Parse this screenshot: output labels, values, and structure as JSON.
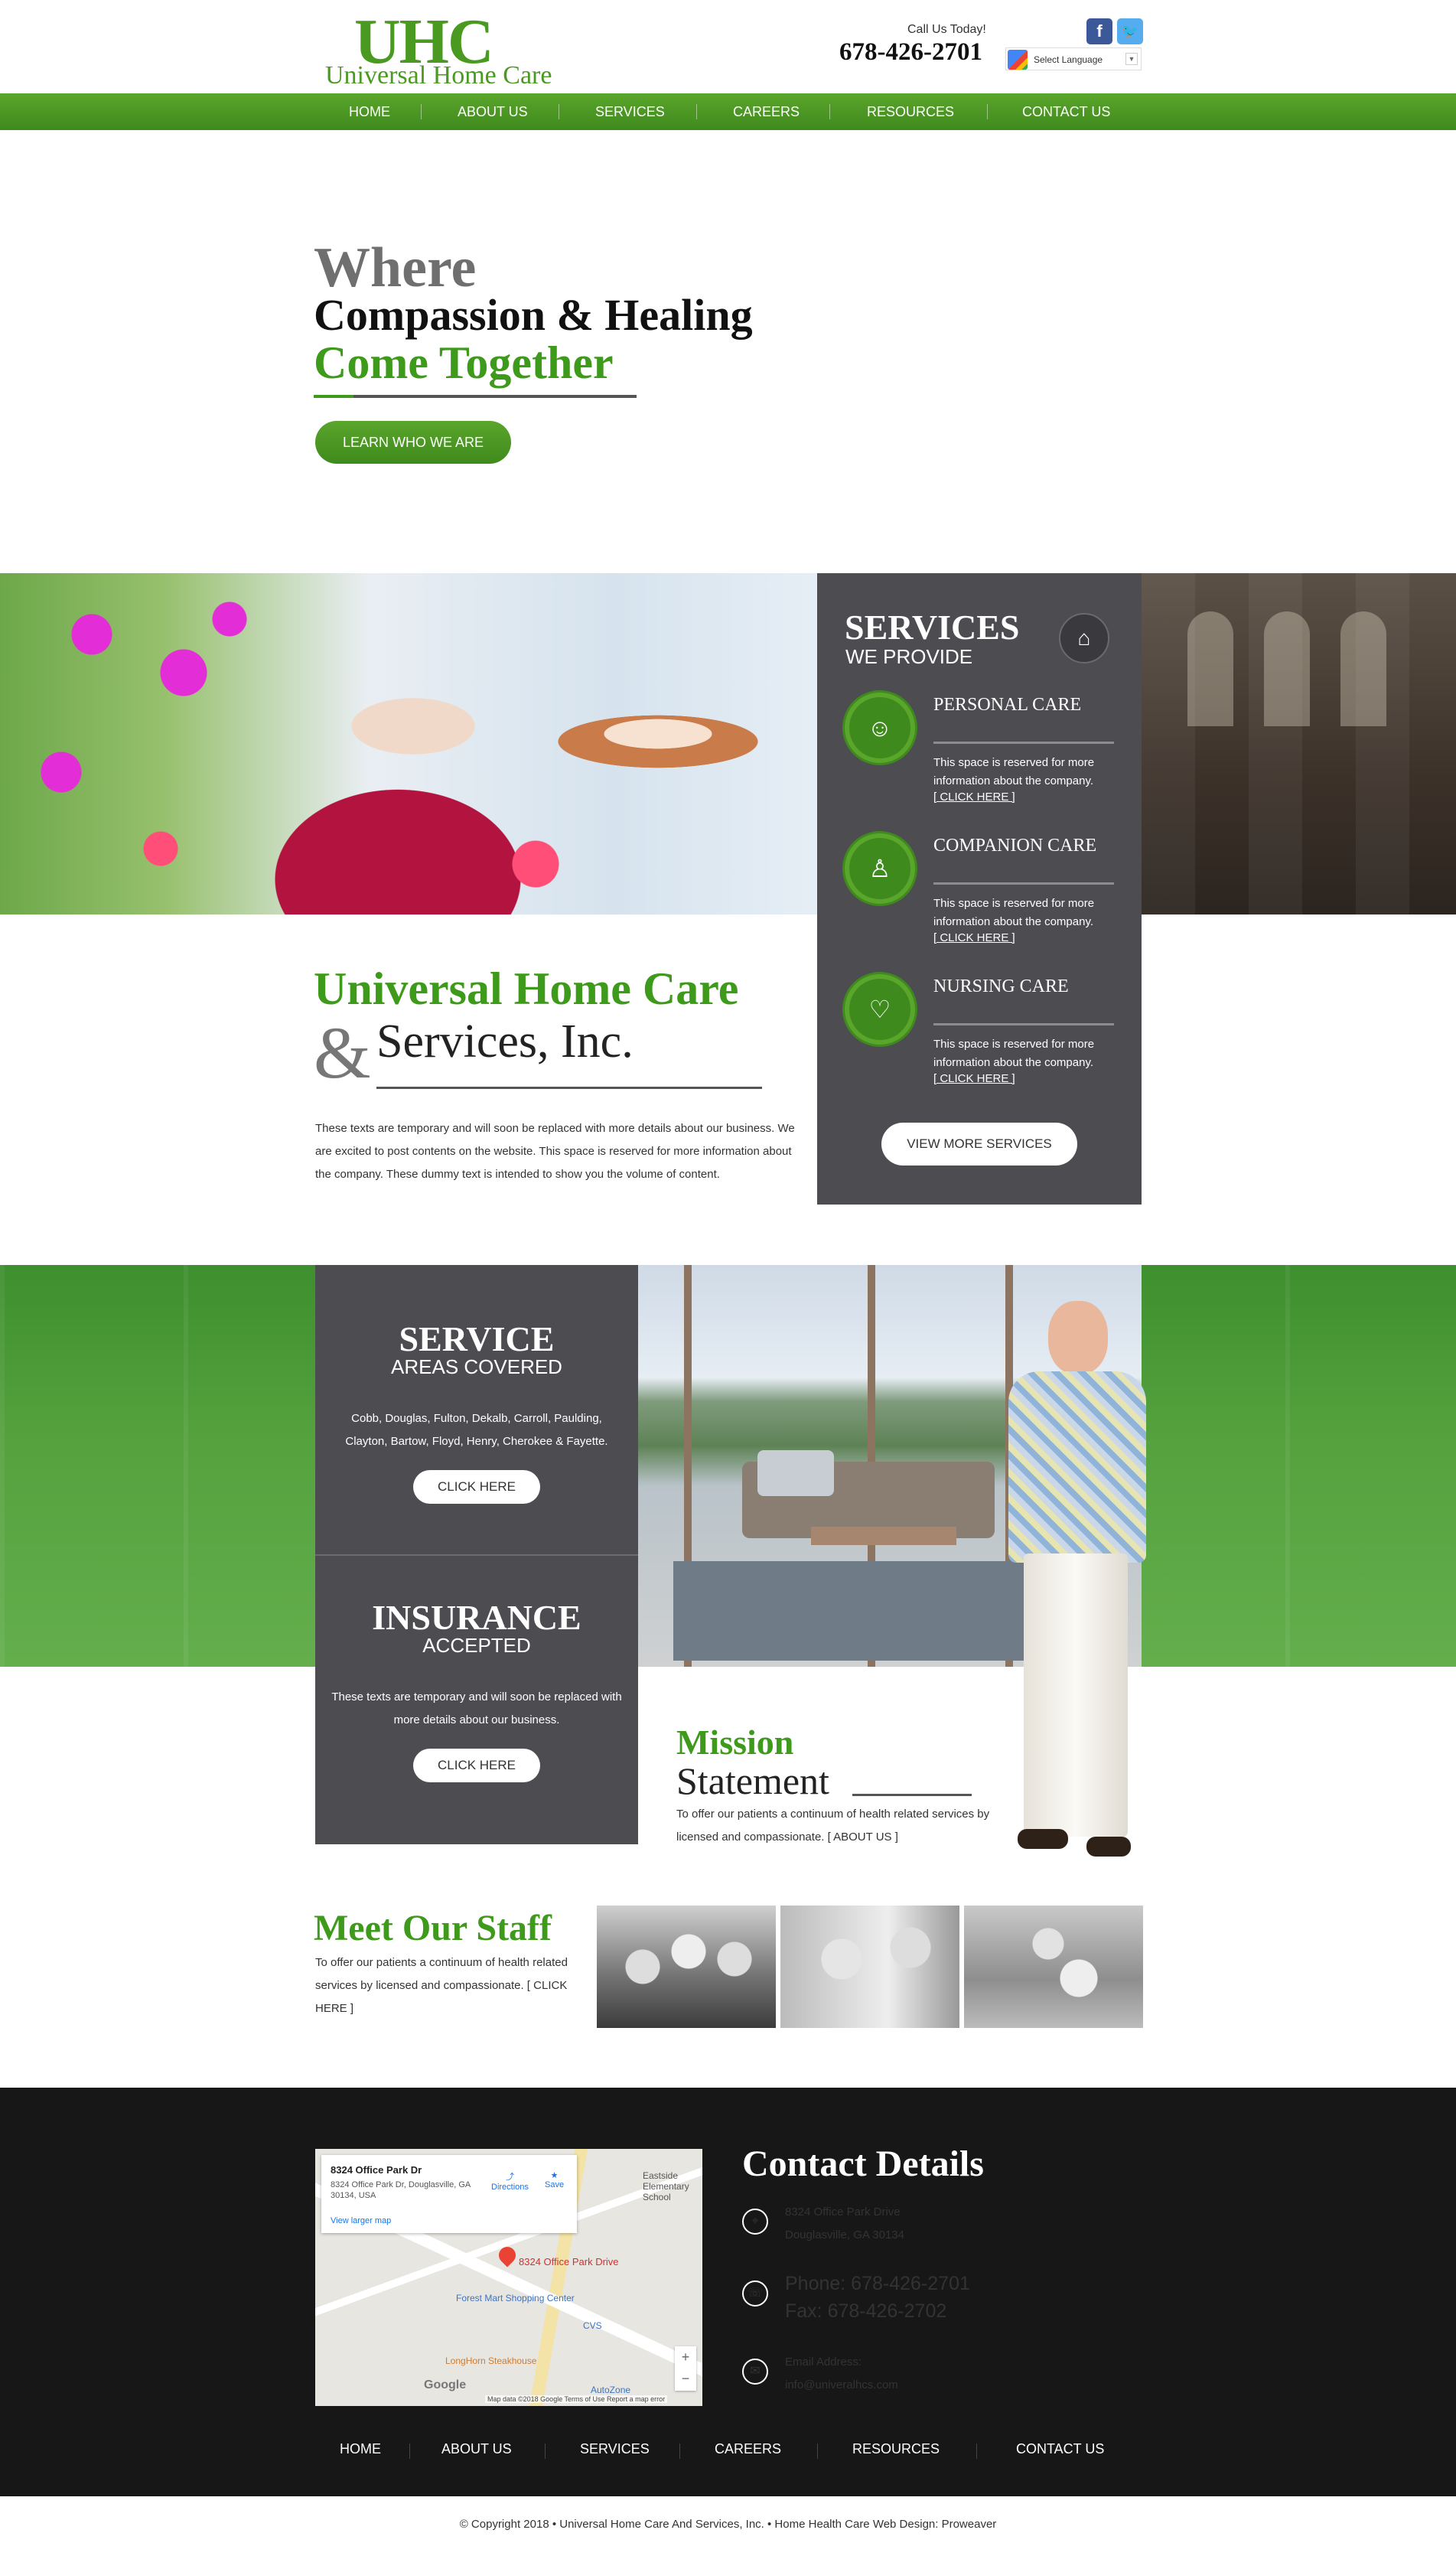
{
  "header": {
    "logo_mark": "UHC",
    "logo_name": "Universal Home Care",
    "call_label": "Call Us Today!",
    "phone": "678-426-2701",
    "facebook_icon": "f",
    "twitter_icon": "t",
    "translate_label": "Select Language"
  },
  "nav": [
    "HOME",
    "ABOUT US",
    "SERVICES",
    "CAREERS",
    "RESOURCES",
    "CONTACT US"
  ],
  "hero": {
    "line1": "Where",
    "line2": "Compassion & Healing",
    "line3": "Come Together",
    "button": "LEARN WHO WE ARE"
  },
  "services_panel": {
    "title": "SERVICES",
    "subtitle": "WE PROVIDE",
    "items": [
      {
        "name": "PERSONAL CARE",
        "desc": "This space is reserved for more information about the company.",
        "link": "[ CLICK HERE ]"
      },
      {
        "name": "COMPANION CARE",
        "desc": "This space is reserved for more information about the company.",
        "link": "[ CLICK HERE ]"
      },
      {
        "name": "NURSING CARE",
        "desc": "This space is reserved for more information about the company.",
        "link": "[ CLICK HERE ]"
      }
    ],
    "button": "VIEW MORE SERVICES"
  },
  "company": {
    "title": "Universal Home Care",
    "amp": "&",
    "subtitle": "Services, Inc.",
    "text": "These texts are temporary and will soon be replaced with more details about our business. We are excited to post contents on the website. This space is reserved for more information about the company. These dummy text is intended to show you the volume of content."
  },
  "areas": {
    "title": "SERVICE",
    "subtitle": "AREAS COVERED",
    "text": "Cobb, Douglas, Fulton, Dekalb, Carroll, Paulding, Clayton, Bartow, Floyd, Henry, Cherokee & Fayette.",
    "button": "CLICK HERE"
  },
  "insurance": {
    "title": "INSURANCE",
    "subtitle": "ACCEPTED",
    "text": "These texts are temporary and will soon be replaced with more details about our business.",
    "button": "CLICK HERE"
  },
  "mission": {
    "title1": "Mission",
    "title2": "Statement",
    "text": "To offer our patients a continuum of health related services by licensed and compassionate. [ ABOUT US ]"
  },
  "staff": {
    "title": "Meet Our Staff",
    "text": "To offer our patients a continuum of health related services by licensed and compassionate. [ CLICK HERE ]"
  },
  "map": {
    "place": "8324 Office Park Dr",
    "address": "8324 Office Park Dr, Douglasville, GA 30134, USA",
    "larger": "View larger map",
    "directions": "Directions",
    "save": "Save",
    "pin_label": "8324 Office Park Drive",
    "shop": "Forest Mart Shopping Center",
    "cvs": "CVS",
    "steak": "LongHorn Steakhouse",
    "auto": "AutoZone",
    "school": "Eastside Elementary School",
    "google": "Google",
    "credit": "Map data ©2018 Google   Terms of Use   Report a map error"
  },
  "contact": {
    "title": "Contact Details",
    "address_line1": "8324 Office Park Drive",
    "address_line2": "Douglasville, GA 30134",
    "phone": "Phone: 678-426-2701",
    "fax": "Fax: 678-426-2702",
    "email_label": "Email Address:",
    "email": "info@univeralhcs.com"
  },
  "footer_nav": [
    "HOME",
    "ABOUT US",
    "SERVICES",
    "CAREERS",
    "RESOURCES",
    "CONTACT US"
  ],
  "copyright": "© Copyright 2018  •  Universal Home Care And Services, Inc.  •  Home Health Care Web Design: Proweaver",
  "colors": {
    "brand_green": "#3d9a1a",
    "panel_gray": "#4d4c51",
    "footer_black": "#171717"
  }
}
